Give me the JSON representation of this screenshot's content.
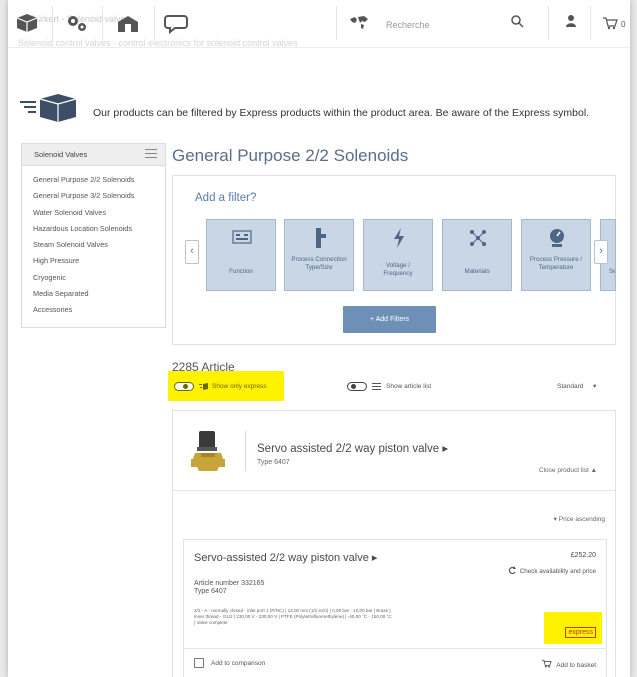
{
  "topbar": {
    "ghost_breadcrumb": "Bürkert - Solenoid valves",
    "ghost_subline": "Solenoid control valves · control electronics for solenoid control valves",
    "search_placeholder": "Recherche",
    "cart_count": "0"
  },
  "express_banner": {
    "text": "Our products can be filtered by Express products within the product area. Be aware of the Express symbol."
  },
  "sidebar": {
    "title": "Solenoid Valves",
    "items": [
      "General Purpose 2/2 Solenoids",
      "General Purpose 3/2 Solenoids",
      "Water Solenoid Valves",
      "Hazardous Location Solenoids",
      "Steam Solenoid Valves",
      "High Pressure",
      "Cryogenic",
      "Media Separated",
      "Accessories"
    ]
  },
  "main": {
    "title": "General Purpose 2/2 Solenoids",
    "filter_prompt": "Add a filter?",
    "filters": [
      {
        "label": "Function",
        "icon": "function-icon"
      },
      {
        "label": "Process Connection Type/Size",
        "icon": "connection-icon"
      },
      {
        "label": "Voltage / Frequency",
        "icon": "voltage-icon"
      },
      {
        "label": "Materials",
        "icon": "materials-icon"
      },
      {
        "label": "Process Pressure / Temperature",
        "icon": "pressure-icon"
      },
      {
        "label": "Se",
        "icon": "partial-icon"
      }
    ],
    "add_filters_label": "+ Add Filters",
    "article_count": "2285 Article",
    "show_only_express": "Show only express",
    "show_article_list": "Show article list",
    "sort_label": "Standard",
    "colors": {
      "accent": "#5b7ca8",
      "highlight": "#fff200",
      "express_red": "#c0392b"
    }
  },
  "product": {
    "title": "Servo assisted 2/2 way piston valve ▸",
    "type": "Type 6407",
    "close_list": "Close product list ▲",
    "price_sort": "▾ Price ascending",
    "item": {
      "title": "Servo-assisted 2/2 way piston valve ▸",
      "article_number": "Article number 332165",
      "type": "Type 6407",
      "description": "2/2 - A - normally closed - inlet port 1 (P/NC) | 13,00 mm (1/2 inch) | 0,00 bar - 10,00 bar | Brass | inner thread - G1/2 | 230,00 V - 230,00 V | PTFE (Polytetrafluoroethylene) | -40,00 °C - 150,00 °C | Valve complete",
      "price": "£252.20",
      "availability": "Check availability and price",
      "express_label": "express",
      "compare_label": "Add to comparison",
      "basket_label": "Add to basket"
    }
  }
}
